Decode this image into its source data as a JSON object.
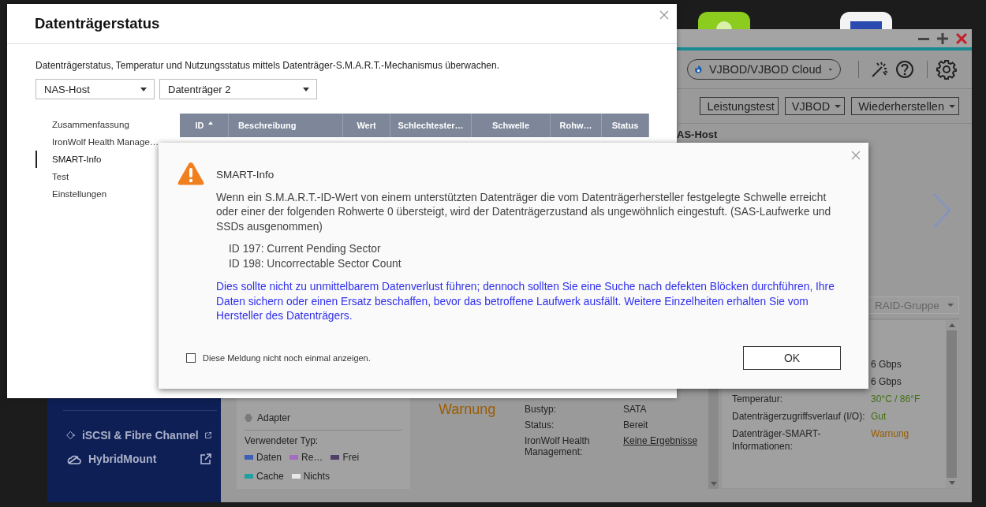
{
  "back_window": {
    "toolbar": {
      "cloud_dropdown": "VJBOD/VJBOD Cloud"
    },
    "actions": [
      {
        "label": "Leistungstest",
        "dropdown": false
      },
      {
        "label": "VJBOD",
        "dropdown": true
      },
      {
        "label": "Wiederherstellen",
        "dropdown": true
      }
    ],
    "host_label": "AS-Host",
    "group_dropdown": "RAID-Gruppe",
    "sidebar": {
      "items": [
        {
          "label": "iSCSI & Fibre Channel",
          "kind": "diamond"
        },
        {
          "label": "HybridMount",
          "kind": "cloud"
        }
      ]
    },
    "legend": {
      "items": [
        {
          "label": "Adapter"
        }
      ],
      "used_type": {
        "title": "Verwendeter Typ:",
        "items": [
          {
            "label": "Daten",
            "color": "#3f5fb7"
          },
          {
            "label": "Re…",
            "color": "#a46cc0"
          },
          {
            "label": "Frei",
            "color": "#4f4068"
          },
          {
            "label": "Cache",
            "color": "#20a0a0"
          },
          {
            "label": "Nichts",
            "color": "#e8e8e8"
          }
        ]
      }
    },
    "health": "Warnung",
    "info": [
      {
        "label": "Bustyp:",
        "value": "SATA",
        "link": false
      },
      {
        "label": "Status:",
        "value": "Bereit",
        "link": false
      },
      {
        "label": "IronWolf Health Management:",
        "value": "Keine Ergebnisse",
        "link": true
      }
    ],
    "details": [
      {
        "value": "6 Gbps"
      },
      {
        "value": "6 Gbps"
      },
      {
        "label": "Temperatur:",
        "value": "30°C / 86°F",
        "color": "#3f7010"
      },
      {
        "label": "Datenträgerzugriffsverlauf (I/O):",
        "value": "Gut",
        "color": "#3f7010"
      },
      {
        "label": "Datenträger-SMART-Informationen:",
        "value": "Warnung",
        "color": "#9a5c00"
      }
    ]
  },
  "status_window": {
    "title": "Datenträgerstatus",
    "description": "Datenträgerstatus, Temperatur und Nutzungsstatus mittels Datenträger-S.M.A.R.T.-Mechanismus überwachen.",
    "host_select": "NAS-Host",
    "disk_select": "Datenträger 2",
    "nav": [
      {
        "label": "Zusammenfassung",
        "selected": false
      },
      {
        "label": "IronWolf Health Manage…",
        "selected": false
      },
      {
        "label": "SMART-Info",
        "selected": true
      },
      {
        "label": "Test",
        "selected": false
      },
      {
        "label": "Einstellungen",
        "selected": false
      }
    ],
    "table": {
      "columns": [
        {
          "label": "ID",
          "sorted": true
        },
        {
          "label": "Beschreibung",
          "sorted": false
        },
        {
          "label": "Wert",
          "sorted": false
        },
        {
          "label": "Schlechtester…",
          "sorted": false
        },
        {
          "label": "Schwelle",
          "sorted": false
        },
        {
          "label": "Rohw…",
          "sorted": false
        },
        {
          "label": "Status",
          "sorted": false
        }
      ]
    }
  },
  "smart_dialog": {
    "title": "SMART-Info",
    "body": "Wenn ein S.M.A.R.T.-ID-Wert von einem unterstützten Datenträger die vom Datenträgerhersteller festgelegte Schwelle erreicht oder einer der folgenden Rohwerte 0 übersteigt, wird der Datenträgerzustand als ungewöhnlich eingestuft. (SAS-Laufwerke und SSDs ausgenommen)",
    "ids": [
      "ID 197: Current Pending Sector",
      "ID 198: Uncorrectable Sector Count"
    ],
    "advice": "Dies sollte nicht zu unmittelbarem Datenverlust führen; dennoch sollten Sie eine Suche nach defekten Blöcken durchführen, Ihre Daten sichern oder einen Ersatz beschaffen, bevor das betroffene Laufwerk ausfällt. Weitere Einzelheiten erhalten Sie vom Hersteller des Datenträgers.",
    "dont_show_again": {
      "label": "Diese Meldung nicht noch einmal anzeigen.",
      "checked": false
    },
    "ok_button": "OK"
  }
}
